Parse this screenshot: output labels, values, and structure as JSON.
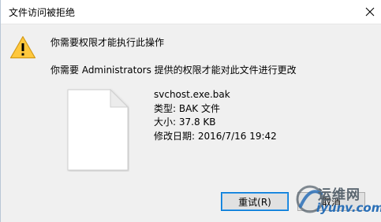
{
  "window": {
    "title": "文件访问被拒绝",
    "close_glyph": "close-icon"
  },
  "message": {
    "main_instruction": "你需要权限才能执行此操作",
    "detail": "你需要 Administrators 提供的权限才能对此文件进行更改",
    "icon": "warning-icon"
  },
  "file": {
    "icon": "file-icon",
    "name": "svchost.exe.bak",
    "type_line": "类型: BAK 文件",
    "size_line": "大小: 37.8 KB",
    "modified_line": "修改日期: 2016/7/16 19:42"
  },
  "buttons": {
    "retry": "重试(R)",
    "cancel": "取消"
  },
  "watermark": {
    "text_cn": "运维网",
    "url": "iyunv.com"
  },
  "colors": {
    "dialog_bg": "#f0f0f0",
    "titlebar_bg": "#ffffff",
    "warning_yellow": "#ffc83d",
    "default_button_border": "#0078d7",
    "watermark_blue": "#2a6fb7"
  }
}
